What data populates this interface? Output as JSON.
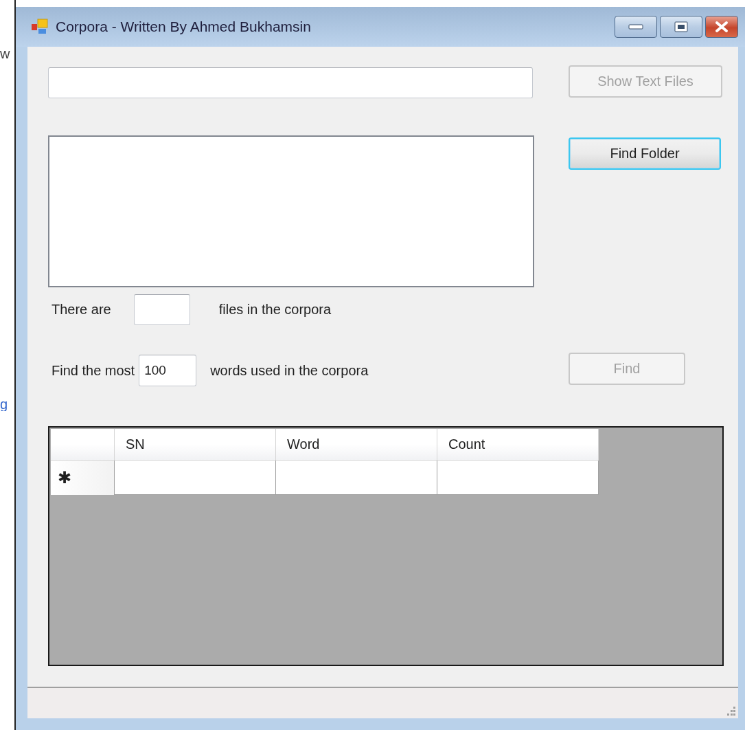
{
  "background_window": {
    "texts": [
      "w",
      "g"
    ]
  },
  "window": {
    "title": "Corpora - Written By Ahmed Bukhamsin"
  },
  "show_text_files_button": {
    "label": "Show Text Files",
    "disabled": true
  },
  "find_folder_button": {
    "label": "Find Folder",
    "disabled": false,
    "focused": true
  },
  "file_count": {
    "label_before": "There are",
    "label_after": "files in the corpora"
  },
  "most_words": {
    "label_before": "Find the most",
    "value": "100",
    "label_after": "words used in the corpora"
  },
  "find_button": {
    "label": "Find",
    "disabled": true
  },
  "grid": {
    "columns": [
      "SN",
      "Word",
      "Count"
    ],
    "new_row_marker": "✱"
  }
}
